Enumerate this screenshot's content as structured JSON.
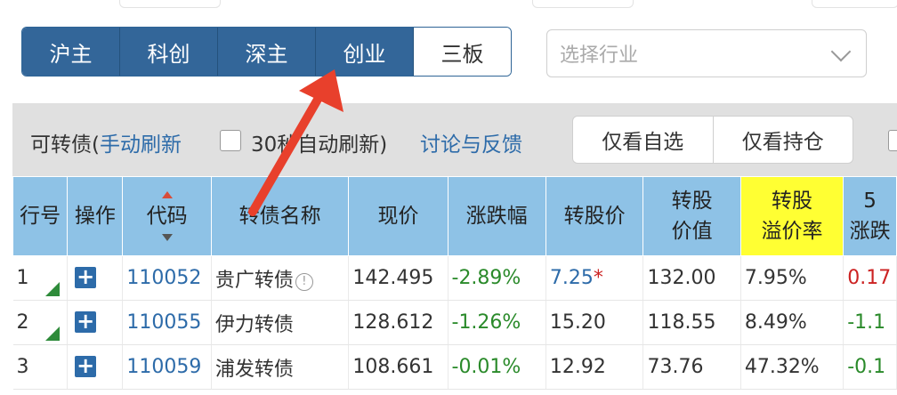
{
  "market_tabs": [
    {
      "label": "沪主"
    },
    {
      "label": "科创"
    },
    {
      "label": "深主"
    },
    {
      "label": "创业"
    },
    {
      "label": "三板"
    }
  ],
  "industry_select": {
    "placeholder": "选择行业"
  },
  "toolbar": {
    "prefix": "可转债(",
    "manual_refresh": "手动刷新",
    "auto_refresh": "30秒自动刷新)",
    "feedback": "讨论与反馈",
    "only_watchlist": "仅看自选",
    "only_holdings": "仅看持仓"
  },
  "table": {
    "headers": [
      {
        "line1": "行号",
        "line2": ""
      },
      {
        "line1": "操作",
        "line2": ""
      },
      {
        "line1": "代码",
        "line2": ""
      },
      {
        "line1": "转债名称",
        "line2": ""
      },
      {
        "line1": "现价",
        "line2": ""
      },
      {
        "line1": "涨跌幅",
        "line2": ""
      },
      {
        "line1": "转股价",
        "line2": ""
      },
      {
        "line1": "转股",
        "line2": "价值"
      },
      {
        "line1": "转股",
        "line2": "溢价率"
      },
      {
        "line1": "5",
        "line2": "涨跌"
      }
    ],
    "rows": [
      {
        "no": "1",
        "code": "110052",
        "name": "贵广转债",
        "price": "142.495",
        "change": "-2.89%",
        "conv_price": "7.25",
        "conv_mark": "*",
        "conv_value": "132.00",
        "premium": "7.95%",
        "extra": "0.17"
      },
      {
        "no": "2",
        "code": "110055",
        "name": "伊力转债",
        "price": "128.612",
        "change": "-1.26%",
        "conv_price": "15.20",
        "conv_mark": "",
        "conv_value": "118.55",
        "premium": "8.49%",
        "extra": "-1.1"
      },
      {
        "no": "3",
        "code": "110059",
        "name": "浦发转债",
        "price": "108.661",
        "change": "-0.01%",
        "conv_price": "12.92",
        "conv_mark": "",
        "conv_value": "73.76",
        "premium": "47.32%",
        "extra": "-0.1"
      }
    ]
  },
  "icons": {
    "add": "+",
    "info": "!"
  },
  "colors": {
    "tab_active": "#336699",
    "header_bg": "#8ec2e6",
    "highlight_header": "#ffff33",
    "negative": "#2a8a2a",
    "positive": "#cc2222",
    "link": "#2d6ba9",
    "annotation_arrow": "#e8402c"
  }
}
